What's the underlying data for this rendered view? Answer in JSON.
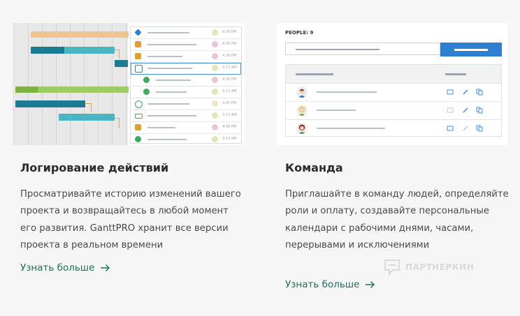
{
  "cards": [
    {
      "title": "Логирование действий",
      "description": "Просматривайте историю изменений вашего проекта и возвращайтесь в любой момент его развития. GanttPRO хранит все версии проекта в реальном времени",
      "link_label": "Узнать больше",
      "link_icon": "arrow-right-icon"
    },
    {
      "title": "Команда",
      "description": "Приглашайте в команду людей, определяйте роли и оплату, создавайте персональные календари с рабочими днями, часами, перерывами и исключениями",
      "link_label": "Узнать больше",
      "link_icon": "arrow-right-icon"
    }
  ],
  "history_thumbnail": {
    "entries": [
      {
        "icon": "diamond-icon",
        "icon_color": "#2d7fd0",
        "dot_color": "#dfe8b5",
        "time": "4:30 PM"
      },
      {
        "icon": "tasks-icon",
        "icon_color": "#e0a030",
        "dot_color": "#e7c6dc",
        "time": "4:30 PM"
      },
      {
        "icon": "tasks-icon",
        "icon_color": "#e0a030",
        "dot_color": "#e7c6dc",
        "time": "4:30 PM"
      },
      {
        "icon": "folder-icon",
        "icon_color": "#2d7fd0",
        "dot_color": "#dfe8b5",
        "time": "3:13 AM"
      },
      {
        "icon": "link-gear-icon",
        "icon_color": "#3daa5f",
        "dot_color": "#e7c6dc",
        "time": "4:30 PM"
      },
      {
        "icon": "link-gear-icon",
        "icon_color": "#3daa5f",
        "dot_color": "#dfe8b5",
        "time": "3:13 AM"
      },
      {
        "icon": "history-icon",
        "icon_color": "#3daa5f",
        "dot_color": "#f1e3c8",
        "time": "4:45 PM"
      },
      {
        "icon": "bar-icon",
        "icon_color": "#3daa5f",
        "dot_color": "#dfe8b5",
        "time": "3:13 AM"
      },
      {
        "icon": "calendar-icon",
        "icon_color": "#e0a030",
        "dot_color": "#e7c6dc",
        "time": "4:40 PM"
      },
      {
        "icon": "move-icon",
        "icon_color": "#3daa5f",
        "dot_color": "#dfe8b5",
        "time": "3:13 AM"
      }
    ],
    "bar_colors": {
      "orange": "#f0c48d",
      "teal_dark": "#1b7b93",
      "teal_light": "#4ab6c4",
      "green": "#7cb342",
      "link": "#e1a54b"
    }
  },
  "team_thumbnail": {
    "people_label": "PEOPLE: 9",
    "accent": "#2d7fd0",
    "members": [
      {
        "avatar": "avatar-man-icon"
      },
      {
        "avatar": "avatar-woman-icon"
      },
      {
        "avatar": "avatar-girl-icon"
      }
    ]
  },
  "watermark": "ПАРТНЕРКИН"
}
